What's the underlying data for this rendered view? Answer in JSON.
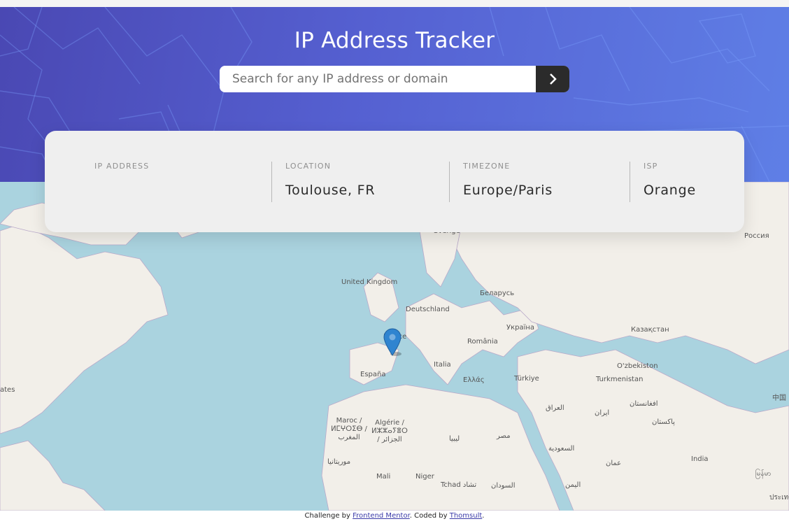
{
  "header": {
    "title": "IP Address Tracker",
    "search_placeholder": "Search for any IP address or domain",
    "search_value": "",
    "submit_icon": "chevron-right-icon",
    "gradient_colors": [
      "#4a48b3",
      "#5f7fe6"
    ]
  },
  "info": {
    "ip_address": {
      "label": "IP ADDRESS",
      "value": ""
    },
    "location": {
      "label": "LOCATION",
      "value": "Toulouse, FR"
    },
    "timezone": {
      "label": "TIMEZONE",
      "value": "Europe/Paris"
    },
    "isp": {
      "label": "ISP",
      "value": "Orange"
    }
  },
  "map": {
    "marker_icon": "map-pin-icon",
    "labels": [
      "Россия",
      "United Kingdom",
      "Беларусь",
      "Deutschland",
      "Україна",
      "Казақстан",
      "France",
      "România",
      "Italia",
      "O'zbekiston",
      "España",
      "Ελλάς",
      "Türkiye",
      "Turkmenistan",
      "中国",
      "العراق",
      "افغانستان",
      "ایران",
      "پاکستان",
      "Maroc / ⵍⵎⵖⵔⵉⴱ / المغرب",
      "Algérie / ⵍⵣⵣⴰⵢⴻⵔ / الجزائر",
      "ليبيا",
      "مصر",
      "السعودية",
      "عمان",
      "India",
      "موريتانيا",
      "Mali",
      "Niger",
      "Tchad تشاد",
      "السودان",
      "اليمن",
      "ates",
      "Sverige",
      "မြန်မာ",
      "ประเทศ"
    ]
  },
  "footer": {
    "prefix": "Challenge by ",
    "link1": "Frontend Mentor",
    "middle": ". Coded by ",
    "link2": "Thomsult",
    "suffix": "."
  }
}
